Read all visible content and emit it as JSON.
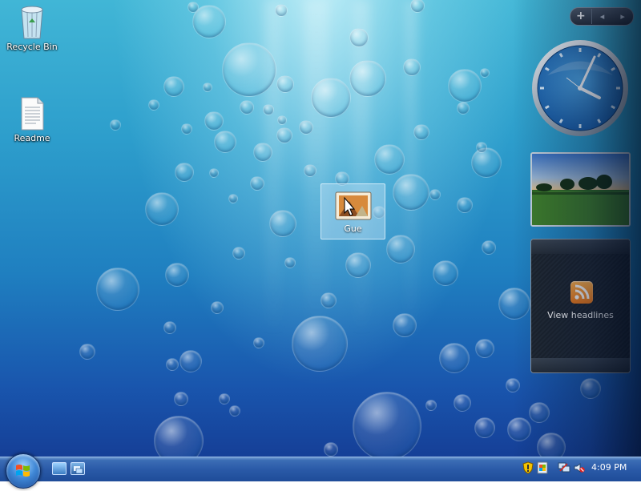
{
  "desktop": {
    "icons": [
      {
        "label": "Recycle Bin",
        "icon": "recycle-bin-icon"
      },
      {
        "label": "Readme",
        "icon": "document-icon"
      },
      {
        "label": "Gue",
        "icon": "image-file-icon",
        "selected": true
      }
    ]
  },
  "sidebar": {
    "controls": {
      "add_label": "+",
      "prev_label": "◂",
      "next_label": "▸"
    },
    "clock_gadget": {
      "hour_hand": "4",
      "minute_hand": "09"
    },
    "slideshow_gadget": {
      "icon": "landscape-photo"
    },
    "feed_gadget": {
      "label": "View headlines",
      "icon": "rss-icon"
    }
  },
  "taskbar": {
    "start_icon": "windows-logo-icon",
    "quick_launch": [
      "show-desktop-icon",
      "switch-windows-icon"
    ],
    "tray_icons": [
      "security-shield-icon",
      "windows-update-icon",
      "network-icon",
      "volume-muted-icon"
    ],
    "time": "4:09 PM"
  },
  "colors": {
    "desktop_top": "#41b6d6",
    "desktop_bottom": "#153f97",
    "taskbar": "#2a5aa8",
    "rss_orange": "#f07818"
  }
}
